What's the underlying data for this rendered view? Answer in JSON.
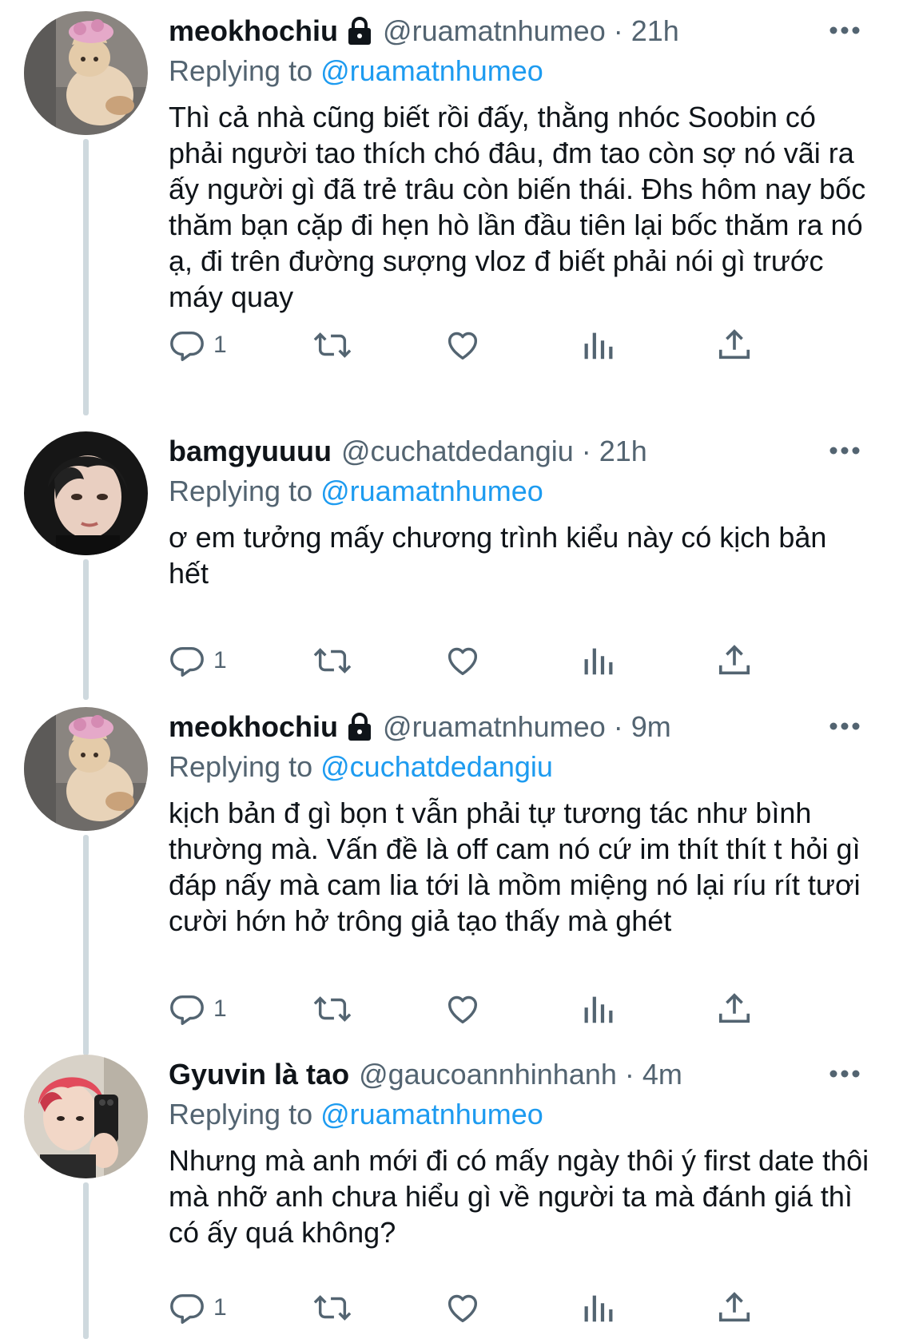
{
  "tweets": [
    {
      "display_name": "meokhochiu",
      "locked": true,
      "handle": "@ruamatnhumeo",
      "separator": "·",
      "time": "21h",
      "replying_label": "Replying to",
      "replying_to": "@ruamatnhumeo",
      "text": "Thì cả nhà cũng biết rồi đấy, thằng nhóc Soobin có phải người tao thích chó đâu, đm tao còn sợ nó vãi ra ấy người gì đã trẻ trâu còn biến thái. Đhs hôm nay bốc thăm bạn cặp đi hẹn hò lần đầu tiên lại bốc thăm ra nó ạ, đi trên đường sượng vloz đ biết phải nói gì trước máy quay",
      "reply_count": "1",
      "avatar": "cat-with-flower-hat"
    },
    {
      "display_name": "bamgyuuuu",
      "locked": false,
      "handle": "@cuchatdedangiu",
      "separator": "·",
      "time": "21h",
      "replying_label": "Replying to",
      "replying_to": "@ruamatnhumeo",
      "text": "ơ em tưởng mấy chương trình kiểu này có kịch bản hết",
      "reply_count": "1",
      "avatar": "young-man-dark-hair"
    },
    {
      "display_name": "meokhochiu",
      "locked": true,
      "handle": "@ruamatnhumeo",
      "separator": "·",
      "time": "9m",
      "replying_label": "Replying to",
      "replying_to": "@cuchatdedangiu",
      "text": "kịch bản đ gì bọn t vẫn phải tự tương tác như bình thường mà. Vấn đề là off cam nó cứ im thít thít t hỏi gì đáp nấy mà cam lia tới là mồm miệng nó lại ríu rít tươi cười hớn hở trông giả tạo thấy mà ghét",
      "reply_count": "1",
      "avatar": "cat-with-flower-hat"
    },
    {
      "display_name": "Gyuvin là tao",
      "locked": false,
      "handle": "@gaucoannhinhanh",
      "separator": "·",
      "time": "4m",
      "replying_label": "Replying to",
      "replying_to": "@ruamatnhumeo",
      "text": "Nhưng mà anh mới đi có mấy ngày thôi ý first date thôi mà nhỡ anh chưa hiểu gì về người ta mà đánh giá thì có ấy quá không?",
      "reply_count": "1",
      "avatar": "red-hair-mirror-selfie"
    }
  ],
  "colors": {
    "text": "#0f1419",
    "secondary": "#536471",
    "link": "#1d9bf0",
    "thread_line": "#cfd9de"
  },
  "icons": [
    "lock-icon",
    "more-icon",
    "reply-icon",
    "retweet-icon",
    "like-icon",
    "analytics-icon",
    "share-icon"
  ]
}
